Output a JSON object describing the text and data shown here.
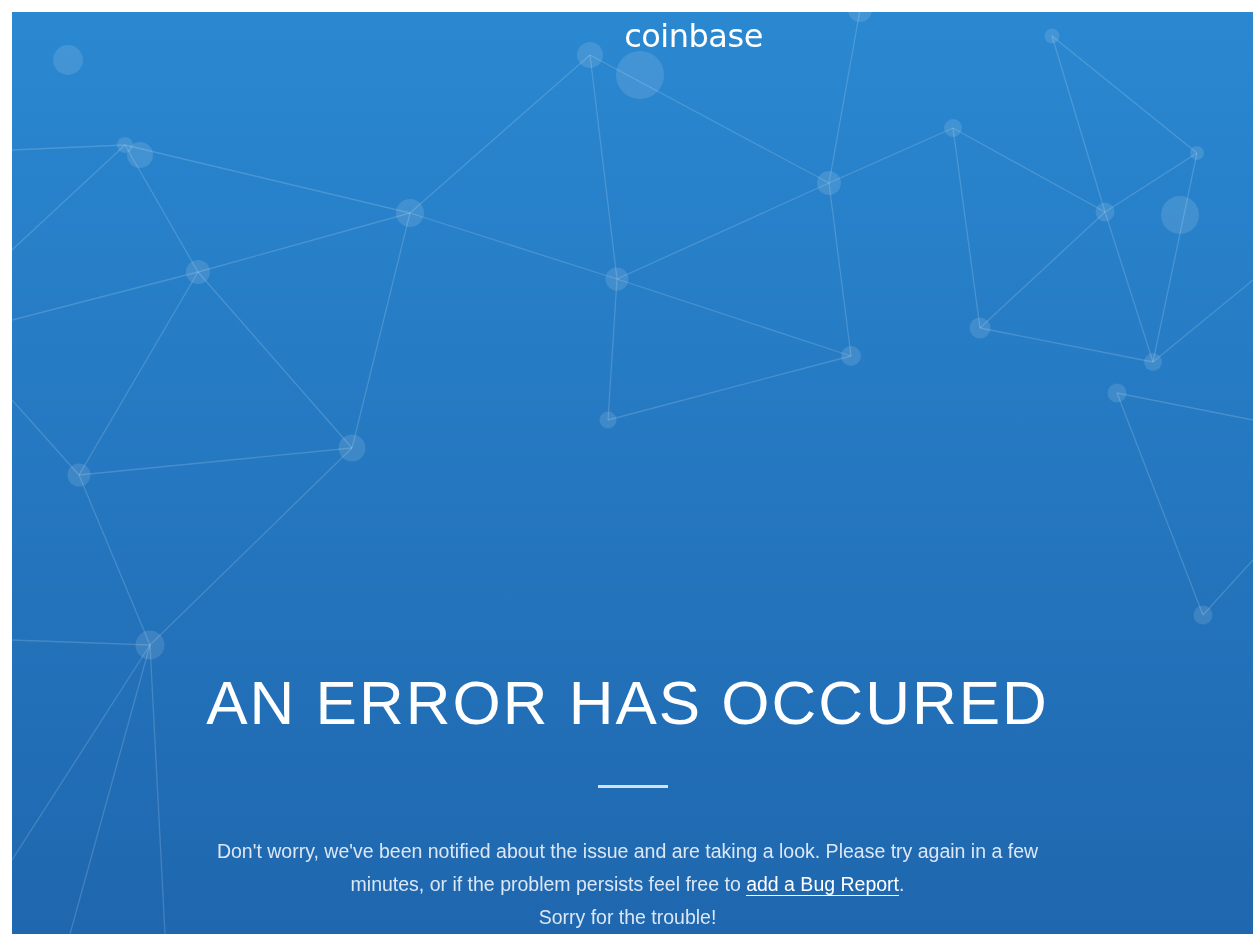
{
  "logo": "coinbase",
  "heading": "AN ERROR HAS OCCURED",
  "message": {
    "text": "Don't worry, we've been notified about the issue and are taking a look. Please try again in a few minutes, or if the problem persists feel free to ",
    "link": "add a Bug Report",
    "after": "."
  },
  "closing": "Sorry for the trouble!"
}
